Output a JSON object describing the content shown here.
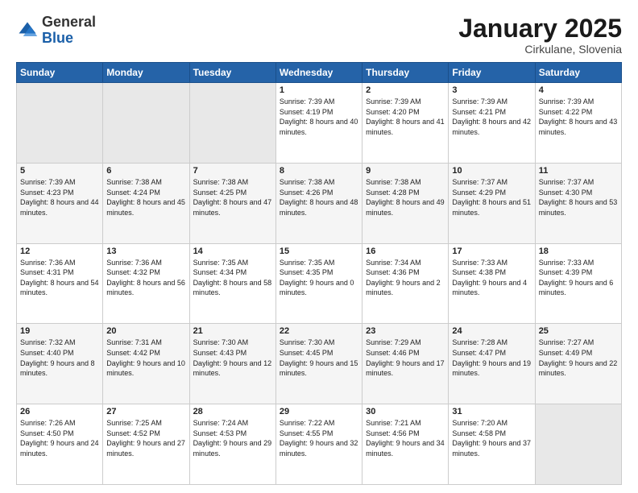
{
  "logo": {
    "general": "General",
    "blue": "Blue"
  },
  "header": {
    "title": "January 2025",
    "subtitle": "Cirkulane, Slovenia"
  },
  "weekdays": [
    "Sunday",
    "Monday",
    "Tuesday",
    "Wednesday",
    "Thursday",
    "Friday",
    "Saturday"
  ],
  "weeks": [
    [
      {
        "day": "",
        "text": ""
      },
      {
        "day": "",
        "text": ""
      },
      {
        "day": "",
        "text": ""
      },
      {
        "day": "1",
        "text": "Sunrise: 7:39 AM\nSunset: 4:19 PM\nDaylight: 8 hours and 40 minutes."
      },
      {
        "day": "2",
        "text": "Sunrise: 7:39 AM\nSunset: 4:20 PM\nDaylight: 8 hours and 41 minutes."
      },
      {
        "day": "3",
        "text": "Sunrise: 7:39 AM\nSunset: 4:21 PM\nDaylight: 8 hours and 42 minutes."
      },
      {
        "day": "4",
        "text": "Sunrise: 7:39 AM\nSunset: 4:22 PM\nDaylight: 8 hours and 43 minutes."
      }
    ],
    [
      {
        "day": "5",
        "text": "Sunrise: 7:39 AM\nSunset: 4:23 PM\nDaylight: 8 hours and 44 minutes."
      },
      {
        "day": "6",
        "text": "Sunrise: 7:38 AM\nSunset: 4:24 PM\nDaylight: 8 hours and 45 minutes."
      },
      {
        "day": "7",
        "text": "Sunrise: 7:38 AM\nSunset: 4:25 PM\nDaylight: 8 hours and 47 minutes."
      },
      {
        "day": "8",
        "text": "Sunrise: 7:38 AM\nSunset: 4:26 PM\nDaylight: 8 hours and 48 minutes."
      },
      {
        "day": "9",
        "text": "Sunrise: 7:38 AM\nSunset: 4:28 PM\nDaylight: 8 hours and 49 minutes."
      },
      {
        "day": "10",
        "text": "Sunrise: 7:37 AM\nSunset: 4:29 PM\nDaylight: 8 hours and 51 minutes."
      },
      {
        "day": "11",
        "text": "Sunrise: 7:37 AM\nSunset: 4:30 PM\nDaylight: 8 hours and 53 minutes."
      }
    ],
    [
      {
        "day": "12",
        "text": "Sunrise: 7:36 AM\nSunset: 4:31 PM\nDaylight: 8 hours and 54 minutes."
      },
      {
        "day": "13",
        "text": "Sunrise: 7:36 AM\nSunset: 4:32 PM\nDaylight: 8 hours and 56 minutes."
      },
      {
        "day": "14",
        "text": "Sunrise: 7:35 AM\nSunset: 4:34 PM\nDaylight: 8 hours and 58 minutes."
      },
      {
        "day": "15",
        "text": "Sunrise: 7:35 AM\nSunset: 4:35 PM\nDaylight: 9 hours and 0 minutes."
      },
      {
        "day": "16",
        "text": "Sunrise: 7:34 AM\nSunset: 4:36 PM\nDaylight: 9 hours and 2 minutes."
      },
      {
        "day": "17",
        "text": "Sunrise: 7:33 AM\nSunset: 4:38 PM\nDaylight: 9 hours and 4 minutes."
      },
      {
        "day": "18",
        "text": "Sunrise: 7:33 AM\nSunset: 4:39 PM\nDaylight: 9 hours and 6 minutes."
      }
    ],
    [
      {
        "day": "19",
        "text": "Sunrise: 7:32 AM\nSunset: 4:40 PM\nDaylight: 9 hours and 8 minutes."
      },
      {
        "day": "20",
        "text": "Sunrise: 7:31 AM\nSunset: 4:42 PM\nDaylight: 9 hours and 10 minutes."
      },
      {
        "day": "21",
        "text": "Sunrise: 7:30 AM\nSunset: 4:43 PM\nDaylight: 9 hours and 12 minutes."
      },
      {
        "day": "22",
        "text": "Sunrise: 7:30 AM\nSunset: 4:45 PM\nDaylight: 9 hours and 15 minutes."
      },
      {
        "day": "23",
        "text": "Sunrise: 7:29 AM\nSunset: 4:46 PM\nDaylight: 9 hours and 17 minutes."
      },
      {
        "day": "24",
        "text": "Sunrise: 7:28 AM\nSunset: 4:47 PM\nDaylight: 9 hours and 19 minutes."
      },
      {
        "day": "25",
        "text": "Sunrise: 7:27 AM\nSunset: 4:49 PM\nDaylight: 9 hours and 22 minutes."
      }
    ],
    [
      {
        "day": "26",
        "text": "Sunrise: 7:26 AM\nSunset: 4:50 PM\nDaylight: 9 hours and 24 minutes."
      },
      {
        "day": "27",
        "text": "Sunrise: 7:25 AM\nSunset: 4:52 PM\nDaylight: 9 hours and 27 minutes."
      },
      {
        "day": "28",
        "text": "Sunrise: 7:24 AM\nSunset: 4:53 PM\nDaylight: 9 hours and 29 minutes."
      },
      {
        "day": "29",
        "text": "Sunrise: 7:22 AM\nSunset: 4:55 PM\nDaylight: 9 hours and 32 minutes."
      },
      {
        "day": "30",
        "text": "Sunrise: 7:21 AM\nSunset: 4:56 PM\nDaylight: 9 hours and 34 minutes."
      },
      {
        "day": "31",
        "text": "Sunrise: 7:20 AM\nSunset: 4:58 PM\nDaylight: 9 hours and 37 minutes."
      },
      {
        "day": "",
        "text": ""
      }
    ]
  ]
}
